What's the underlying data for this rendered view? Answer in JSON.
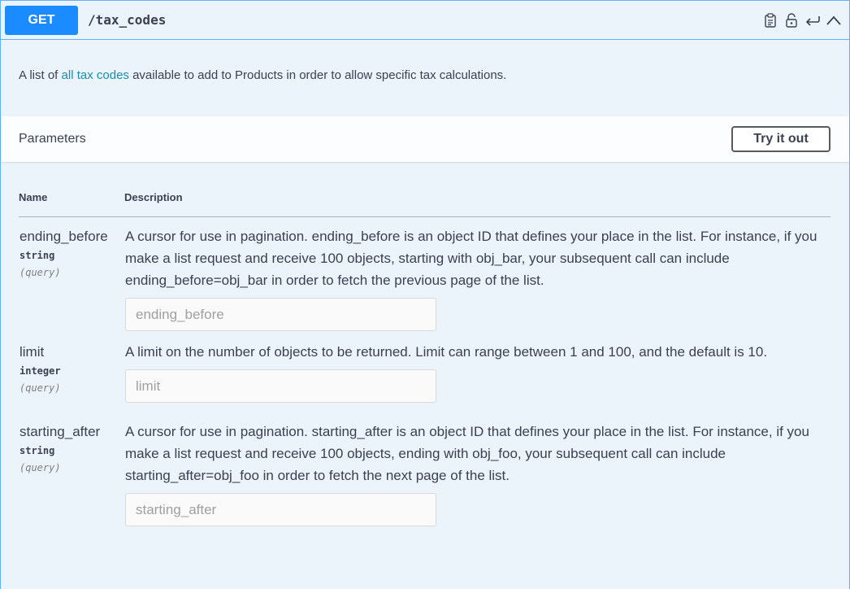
{
  "summary": {
    "method": "GET",
    "path": "/tax_codes",
    "controls": [
      "clipboard-icon",
      "unlock-icon",
      "return-icon",
      "chevron-up-icon"
    ]
  },
  "description": {
    "before": "A list of ",
    "link": "all tax codes",
    "after": " available to add to Products in order to allow specific tax calculations."
  },
  "parameters": {
    "title": "Parameters",
    "try_label": "Try it out",
    "col_name": "Name",
    "col_desc": "Description",
    "items": [
      {
        "name": "ending_before",
        "type": "string",
        "in": "(query)",
        "description": "A cursor for use in pagination. ending_before is an object ID that defines your place in the list. For instance, if you make a list request and receive 100 objects, starting with obj_bar, your subsequent call can include ending_before=obj_bar in order to fetch the previous page of the list.",
        "placeholder": "ending_before"
      },
      {
        "name": "limit",
        "type": "integer",
        "in": "(query)",
        "description": "A limit on the number of objects to be returned. Limit can range between 1 and 100, and the default is 10.",
        "placeholder": "limit"
      },
      {
        "name": "starting_after",
        "type": "string",
        "in": "(query)",
        "description": "A cursor for use in pagination. starting_after is an object ID that defines your place in the list. For instance, if you make a list request and receive 100 objects, ending with obj_foo, your subsequent call can include starting_after=obj_foo in order to fetch the next page of the list.",
        "placeholder": "starting_after"
      }
    ]
  },
  "colors": {
    "method_bg": "#1a8cff",
    "panel_bg": "#ebf3fb",
    "border": "#61affe",
    "link": "#1a8fa8"
  }
}
